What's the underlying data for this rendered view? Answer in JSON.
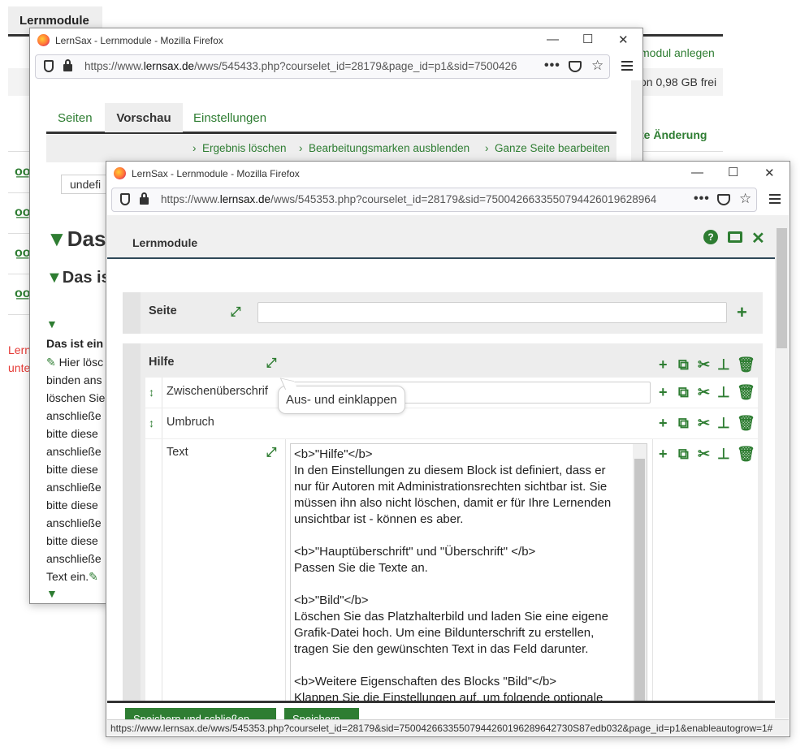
{
  "background": {
    "tab_title": "Lernmodule",
    "create_link": "modul anlegen",
    "quota": "on 0,98 GB frei",
    "last_change": "te Änderung",
    "red_text_1": "Lern",
    "red_text_2": "unte"
  },
  "window1": {
    "title": "LernSax - Lernmodule - Mozilla Firefox",
    "url_prefix": "https://www.",
    "url_domain": "lernsax.de",
    "url_rest": "/wws/545433.php?courselet_id=28179&page_id=p1&sid=7500426",
    "tabs": [
      "Seiten",
      "Vorschau",
      "Einstellungen"
    ],
    "actions": [
      "Ergebnis löschen",
      "Bearbeitungsmarken ausblenden",
      "Ganze Seite bearbeiten"
    ],
    "select_value": "undefi",
    "heading1": "Das",
    "heading2": "Das is",
    "bold_line": "Das ist ein",
    "lines": [
      "Hier lösc",
      "binden ans",
      "löschen Sie",
      "anschließe",
      "bitte diese",
      "anschließe",
      "bitte diese",
      "anschließe",
      "bitte diese",
      "anschließe",
      "bitte diese",
      "anschließe",
      "Text ein."
    ]
  },
  "window2": {
    "title": "LernSax - Lernmodule - Mozilla Firefox",
    "url_prefix": "https://www.",
    "url_domain": "lernsax.de",
    "url_rest": "/wws/545353.php?courselet_id=28179&sid=7500426633550794426019628964",
    "header_title": "Lernmodule",
    "seite_label": "Seite",
    "hilfe_label": "Hilfe",
    "rows": [
      {
        "label": "Zwischenüberschrif"
      },
      {
        "label": "Umbruch"
      },
      {
        "label": "Text"
      }
    ],
    "tooltip": "Aus- und einklappen",
    "textarea": "<b>\"Hilfe\"</b>\nIn den Einstellungen zu diesem Block ist definiert, dass er nur für Autoren mit Administrationsrechten sichtbar ist. Sie müssen ihn also nicht löschen, damit er für Ihre Lernenden unsichtbar ist - können es aber.\n\n<b>\"Hauptüberschrift\" und \"Überschrift\" </b>\nPassen Sie die Texte an.\n\n<b>\"Bild\"</b>\nLöschen Sie das Platzhalterbild und laden Sie eine eigene Grafik-Datei hoch. Um eine Bildunterschrift zu erstellen, tragen Sie den gewünschten Text in das Feld darunter.\n\n<b>Weitere Eigenschaften des Blocks \"Bild\"</b>\nKlappen Sie die Einstellungen auf, um folgende optionale",
    "btn_save_close": "Speichern und schließen",
    "btn_save": "Speichern",
    "status_url": "https://www.lernsax.de/wws/545353.php?courselet_id=28179&sid=75004266335507944260196289642730S87edb032&page_id=p1&enableautogrow=1#"
  },
  "colors": {
    "accent": "#2e7d32",
    "red": "#e53935"
  }
}
